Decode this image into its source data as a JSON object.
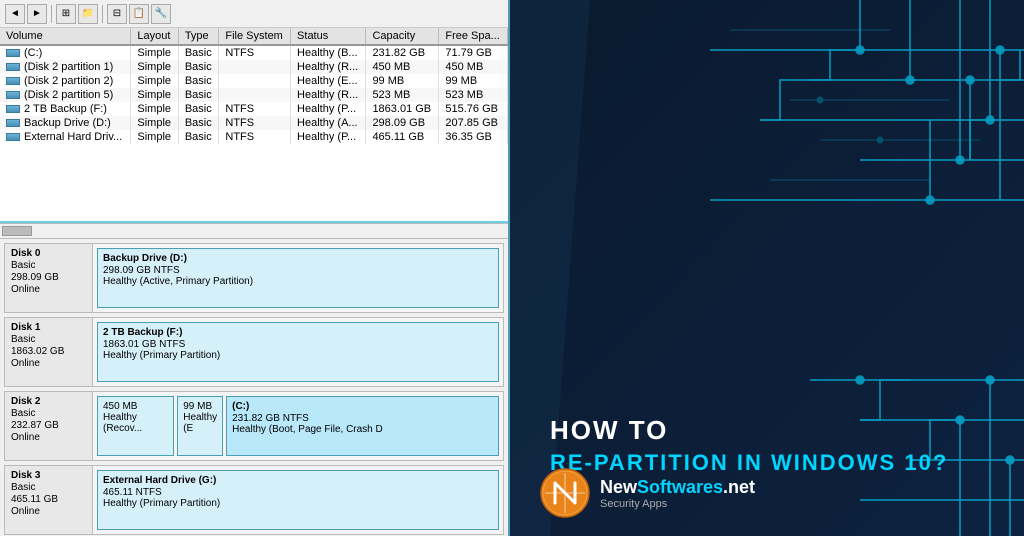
{
  "toolbar": {
    "buttons": [
      "◄",
      "►",
      "⊞",
      "📁",
      "⊟",
      "📋",
      "🔧"
    ]
  },
  "table": {
    "columns": [
      "Volume",
      "Layout",
      "Type",
      "File System",
      "Status",
      "Capacity",
      "Free Spa..."
    ],
    "rows": [
      {
        "volume": "(C:)",
        "layout": "Simple",
        "type": "Basic",
        "filesystem": "NTFS",
        "status": "Healthy (B...",
        "capacity": "231.82 GB",
        "free": "71.79 GB"
      },
      {
        "volume": "(Disk 2 partition 1)",
        "layout": "Simple",
        "type": "Basic",
        "filesystem": "",
        "status": "Healthy (R...",
        "capacity": "450 MB",
        "free": "450 MB"
      },
      {
        "volume": "(Disk 2 partition 2)",
        "layout": "Simple",
        "type": "Basic",
        "filesystem": "",
        "status": "Healthy (E...",
        "capacity": "99 MB",
        "free": "99 MB"
      },
      {
        "volume": "(Disk 2 partition 5)",
        "layout": "Simple",
        "type": "Basic",
        "filesystem": "",
        "status": "Healthy (R...",
        "capacity": "523 MB",
        "free": "523 MB"
      },
      {
        "volume": "2 TB Backup (F:)",
        "layout": "Simple",
        "type": "Basic",
        "filesystem": "NTFS",
        "status": "Healthy (P...",
        "capacity": "1863.01 GB",
        "free": "515.76 GB"
      },
      {
        "volume": "Backup Drive (D:)",
        "layout": "Simple",
        "type": "Basic",
        "filesystem": "NTFS",
        "status": "Healthy (A...",
        "capacity": "298.09 GB",
        "free": "207.85 GB"
      },
      {
        "volume": "External Hard Driv...",
        "layout": "Simple",
        "type": "Basic",
        "filesystem": "NTFS",
        "status": "Healthy (P...",
        "capacity": "465.11 GB",
        "free": "36.35 GB"
      }
    ]
  },
  "disks": [
    {
      "name": "Disk 0",
      "type": "Basic",
      "size": "298.09 GB",
      "status": "Online",
      "partitions": [
        {
          "name": "Backup Drive (D:)",
          "size": "298.09 GB NTFS",
          "status": "Healthy (Active, Primary Partition)",
          "flex": 1,
          "type": "normal"
        }
      ]
    },
    {
      "name": "Disk 1",
      "type": "Basic",
      "size": "1863.02 GB",
      "status": "Online",
      "partitions": [
        {
          "name": "2 TB Backup  (F:)",
          "size": "1863.01 GB NTFS",
          "status": "Healthy (Primary Partition)",
          "flex": 1,
          "type": "normal"
        }
      ]
    },
    {
      "name": "Disk 2",
      "type": "Basic",
      "size": "232.87 GB",
      "status": "Online",
      "partitions": [
        {
          "name": "",
          "size": "450 MB",
          "status": "Healthy (Recov...",
          "flex": 2,
          "type": "small"
        },
        {
          "name": "",
          "size": "99 MB",
          "status": "Healthy (E",
          "flex": 1,
          "type": "small"
        },
        {
          "name": "(C:)",
          "size": "231.82 GB NTFS",
          "status": "Healthy (Boot, Page File, Crash D",
          "flex": 8,
          "type": "system"
        }
      ]
    },
    {
      "name": "Disk 3",
      "type": "Basic",
      "size": "465.11 GB",
      "status": "Online",
      "partitions": [
        {
          "name": "External Hard Drive (G:)",
          "size": "465.11 NTFS",
          "status": "Healthy (Primary Partition)",
          "flex": 1,
          "type": "normal"
        }
      ]
    }
  ],
  "right": {
    "how_to": "HOW TO",
    "re_partition": "RE-PARTITION IN WINDOWS 10?",
    "logo_name_white": "New",
    "logo_name_blue": "Softwares",
    "logo_name_end": ".net",
    "logo_subtitle": "Security Apps"
  }
}
